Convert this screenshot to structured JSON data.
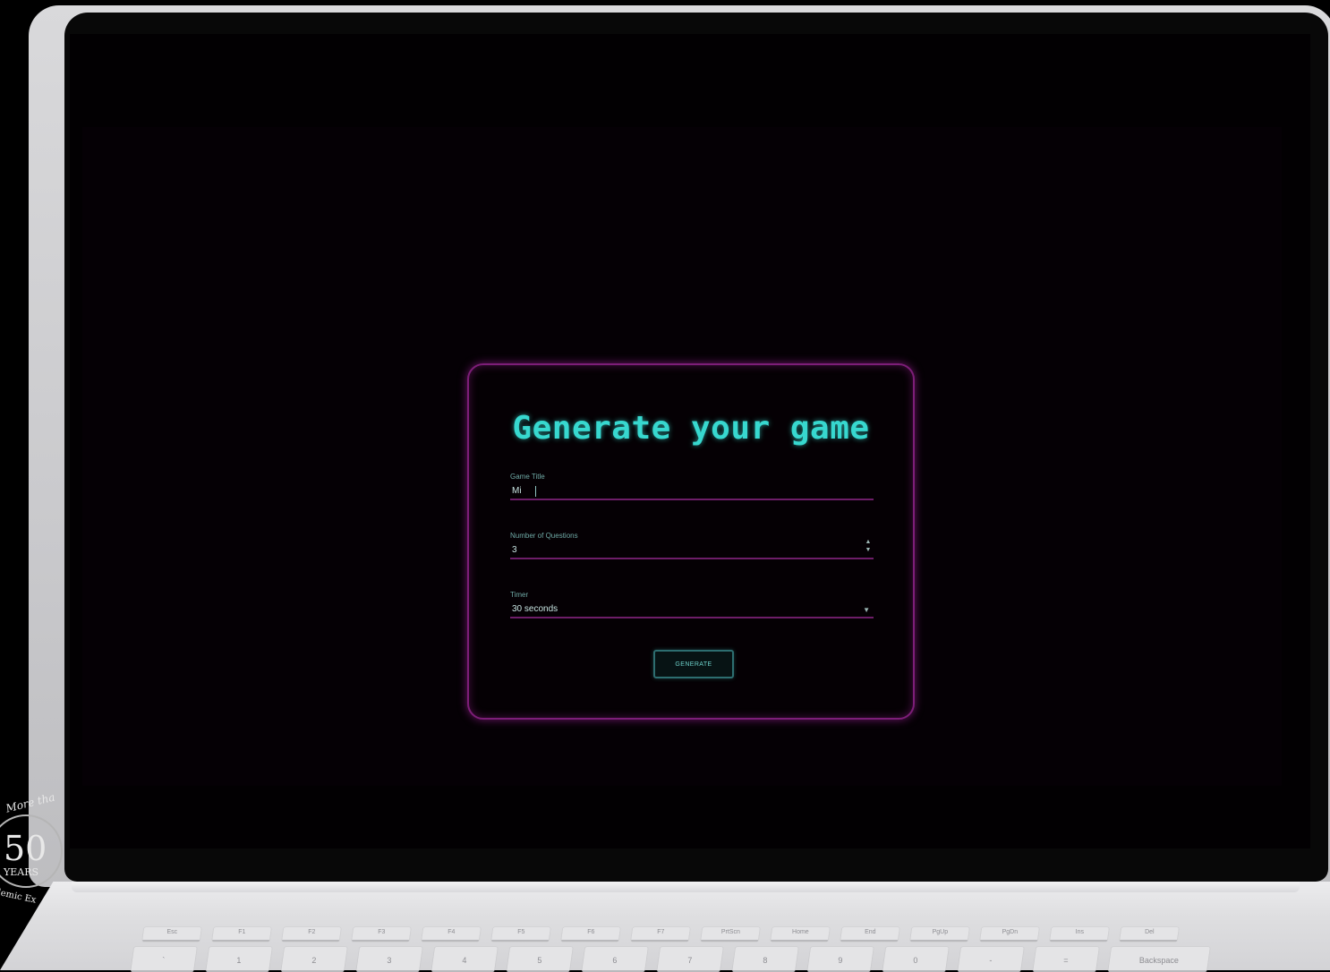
{
  "app": {
    "title": "Generate your game",
    "fields": [
      {
        "label": "Game Title",
        "value": "Mi",
        "control": "text"
      },
      {
        "label": "Number of Questions",
        "value": "3",
        "control": "number"
      },
      {
        "label": "Timer",
        "value": "30 seconds",
        "control": "select"
      }
    ],
    "generate_label": "GENERATE",
    "stepper": {
      "up": "▲",
      "down": "▼"
    },
    "select_chevron": "▼"
  },
  "keyboard": {
    "function_row": [
      "Esc",
      "F1",
      "F2",
      "F3",
      "F4",
      "F5",
      "F6",
      "F7",
      "PrtScn",
      "Home",
      "End",
      "PgUp",
      "PgDn",
      "Ins",
      "Del"
    ],
    "number_row": [
      "`",
      "1",
      "2",
      "3",
      "4",
      "5",
      "6",
      "7",
      "8",
      "9",
      "0",
      "-",
      "=",
      "Backspace"
    ]
  },
  "badge": {
    "top": "More tha",
    "number": "50",
    "years": "YEARS",
    "bottom": "demic Ex"
  },
  "colors": {
    "title": "#37d8cf",
    "card_border": "#7d1e78",
    "screen_background": "#020002",
    "button_border": "#2d6e70"
  }
}
